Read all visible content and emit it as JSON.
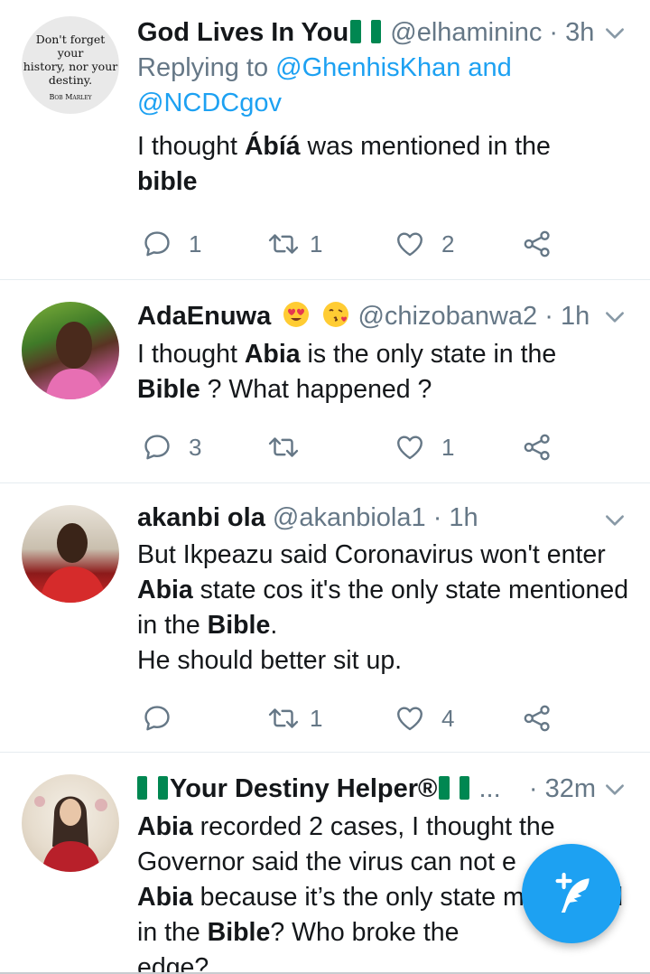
{
  "tweets": [
    {
      "display_name": "God Lives In You",
      "handle": "@elhamininc",
      "time": "3h",
      "reply_prefix": "Replying to",
      "reply_mention_1": "@GhenhisKhan",
      "reply_and": "and",
      "reply_mention_2": "@NCDCgov",
      "text_1": "I thought ",
      "bold_1": "Ábíá",
      "text_2": " was mentioned in the ",
      "bold_2": "bible",
      "replies": "1",
      "retweets": "1",
      "likes": "2",
      "avatar_text": [
        "Don't forget your",
        "history, nor your",
        "destiny.",
        "Bob Marley"
      ]
    },
    {
      "display_name": "AdaEnuwa",
      "handle": "@chizobanwa2",
      "time": "1h",
      "text_1": "I thought ",
      "bold_1": "Abia",
      "text_2": " is the only state in the ",
      "bold_2": "Bible",
      "text_3": " ? What happened ?",
      "replies": "3",
      "retweets": "",
      "likes": "1"
    },
    {
      "display_name": "akanbi ola",
      "handle": "@akanbiola1",
      "time": "1h",
      "text_1": "But Ikpeazu said Coronavirus won't enter ",
      "bold_1": "Abia",
      "text_2": " state cos it's the only state mentioned in the ",
      "bold_2": "Bible",
      "text_3": ".",
      "text_4": "He should better sit up.",
      "replies": "",
      "retweets": "1",
      "likes": "4"
    },
    {
      "display_name": "Your Destiny Helper®",
      "handle": "...",
      "time": "32m",
      "bold_1": "Abia",
      "text_1": " recorded 2 cases, I thought the Governor said the virus can not e",
      "bold_2": "Abia",
      "text_2": " because it’s the only state mentioned in the ",
      "bold_3": "Bible",
      "text_3": "? Who broke the",
      "text_4": "edge?"
    }
  ],
  "colors": {
    "accent": "#1da1f2",
    "secondary_text": "#657786",
    "primary_text": "#14171a",
    "divider": "#e6ecf0",
    "flag_green": "#008751"
  },
  "icons": {
    "reply": "reply-icon",
    "retweet": "retweet-icon",
    "like": "heart-icon",
    "share": "share-icon",
    "caret": "chevron-down-icon",
    "compose": "compose-tweet-icon"
  }
}
